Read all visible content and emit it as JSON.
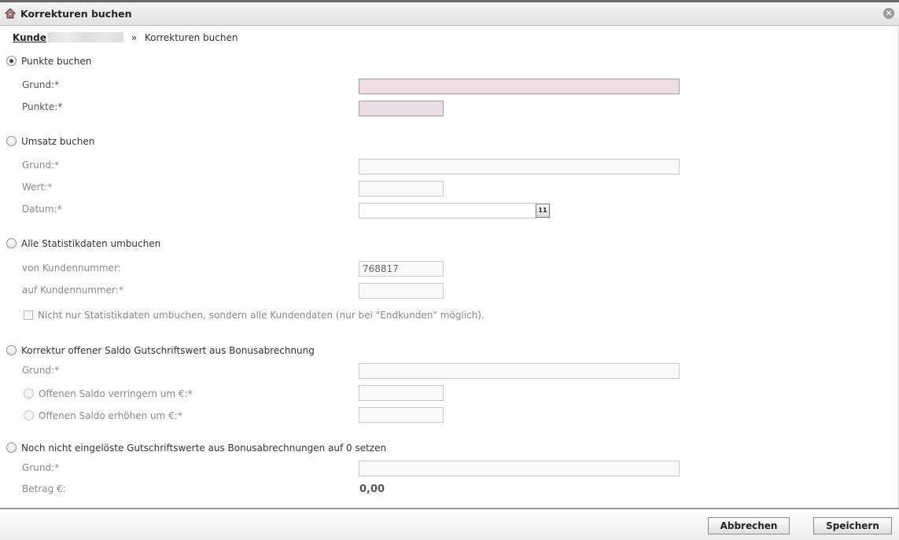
{
  "window": {
    "title": "Korrekturen buchen",
    "close_symbol": "×"
  },
  "breadcrumb": {
    "link": "Kunde",
    "separator": "»",
    "current": "Korrekturen buchen"
  },
  "sections": {
    "punkte": {
      "label": "Punkte buchen",
      "checked": true,
      "grund_label": "Grund:*",
      "punkte_label": "Punkte:*",
      "grund_value": "",
      "punkte_value": ""
    },
    "umsatz": {
      "label": "Umsatz buchen",
      "checked": false,
      "grund_label": "Grund:*",
      "wert_label": "Wert:*",
      "datum_label": "Datum:*",
      "grund_value": "",
      "wert_value": "",
      "datum_value": "",
      "calendar_icon_text": "11"
    },
    "statistik": {
      "label": "Alle Statistikdaten umbuchen",
      "checked": false,
      "von_label": "von Kundennummer:",
      "auf_label": "auf Kundennummer:*",
      "von_value": "768817",
      "auf_value": "",
      "checkbox_label": "Nicht nur Statistikdaten umbuchen, sondern alle Kundendaten (nur bei \"Endkunden\" möglich).",
      "checkbox_checked": false
    },
    "saldo": {
      "label": "Korrektur offener Saldo Gutschriftswert aus Bonusabrechnung",
      "checked": false,
      "grund_label": "Grund:*",
      "verringern_label": "Offenen Saldo verringern um €:*",
      "erhoehen_label": "Offenen Saldo erhöhen um €:*",
      "grund_value": "",
      "verringern_value": "",
      "erhoehen_value": ""
    },
    "gutschrift": {
      "label": "Noch nicht eingelöste Gutschriftswerte aus Bonusabrechnungen auf 0 setzen",
      "checked": false,
      "grund_label": "Grund:*",
      "betrag_label": "Betrag €:",
      "grund_value": "",
      "betrag_value": "0,00"
    }
  },
  "footer": {
    "cancel_label": "Abbrechen",
    "save_label": "Speichern"
  },
  "colors": {
    "required_field": "#eddde5",
    "title_bar": "#e3e3e3"
  },
  "icons": {
    "app": "user-edit-icon",
    "close": "close-icon",
    "calendar": "calendar-icon"
  }
}
